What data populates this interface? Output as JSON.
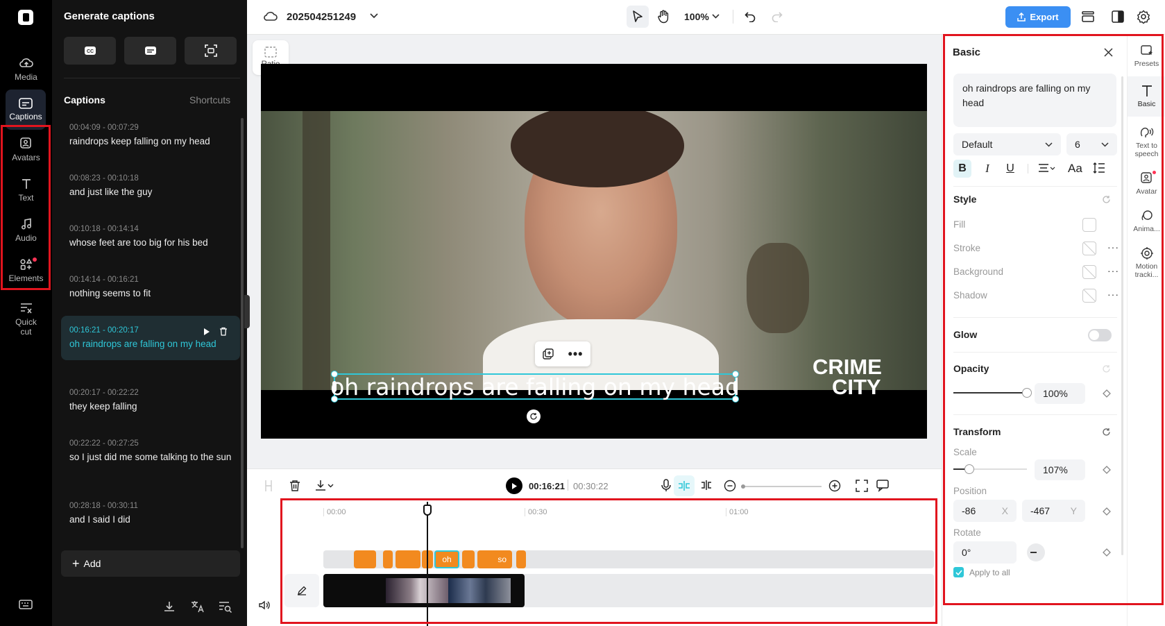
{
  "nav": {
    "items": [
      {
        "label": "Media",
        "icon": "cloud-upload-icon"
      },
      {
        "label": "Captions",
        "icon": "captions-icon"
      },
      {
        "label": "Avatars",
        "icon": "avatar-icon"
      },
      {
        "label": "Text",
        "icon": "text-icon"
      },
      {
        "label": "Audio",
        "icon": "music-note-icon"
      },
      {
        "label": "Elements",
        "icon": "elements-icon"
      },
      {
        "label": "Quick cut",
        "icon": "quick-cut-icon"
      }
    ]
  },
  "caption_panel": {
    "title": "Generate captions",
    "header": "Captions",
    "shortcuts": "Shortcuts",
    "items": [
      {
        "time": "00:04:09 - 00:07:29",
        "text": "raindrops keep falling on my head"
      },
      {
        "time": "00:08:23 - 00:10:18",
        "text": "and just like the guy"
      },
      {
        "time": "00:10:18 - 00:14:14",
        "text": "whose feet are too big for his bed"
      },
      {
        "time": "00:14:14 - 00:16:21",
        "text": "nothing seems to fit"
      },
      {
        "time": "00:16:21 - 00:20:17",
        "text": "oh raindrops are falling on my head"
      },
      {
        "time": "00:20:17 - 00:22:22",
        "text": "they keep falling"
      },
      {
        "time": "00:22:22 - 00:27:25",
        "text": "so I just did me some talking to the sun"
      },
      {
        "time": "00:28:18 - 00:30:11",
        "text": "and I said I did"
      }
    ],
    "add_label": "Add"
  },
  "topbar": {
    "project_name": "202504251249",
    "zoom": "100%",
    "export_label": "Export"
  },
  "canvas": {
    "ratio_label": "Ratio",
    "caption_text": "oh raindrops are falling on my head",
    "watermark_line1": "CRIME",
    "watermark_line2": "CITY"
  },
  "controls": {
    "current_time": "00:16:21",
    "total_time": "00:30:22"
  },
  "timeline": {
    "ticks": [
      "00:00",
      "00:30",
      "01:00"
    ],
    "clip_labels": [
      "oh",
      "so"
    ]
  },
  "right_panel": {
    "title": "Basic",
    "text_value": "oh raindrops are falling on my head",
    "font": "Default",
    "font_size": "6",
    "style_header": "Style",
    "fill": "Fill",
    "stroke": "Stroke",
    "background": "Background",
    "shadow": "Shadow",
    "glow": "Glow",
    "opacity_header": "Opacity",
    "opacity_value": "100%",
    "opacity_fraction": 1.0,
    "transform_header": "Transform",
    "scale_label": "Scale",
    "scale_value": "107%",
    "position_label": "Position",
    "pos_x": "-86",
    "pos_y": "-467",
    "x_label": "X",
    "y_label": "Y",
    "rotate_label": "Rotate",
    "rotate_value": "0°",
    "apply_all": "Apply to all"
  },
  "right_strip": {
    "items": [
      {
        "label": "Presets"
      },
      {
        "label": "Basic"
      },
      {
        "label": "Text to speech"
      },
      {
        "label": "Avatar"
      },
      {
        "label": "Anima..."
      },
      {
        "label": "Motion tracki..."
      }
    ]
  },
  "colors": {
    "accent": "#2fc7d8",
    "export": "#3b8ff3",
    "clip_orange": "#f28a1f",
    "highlight_red": "#e1141e"
  }
}
